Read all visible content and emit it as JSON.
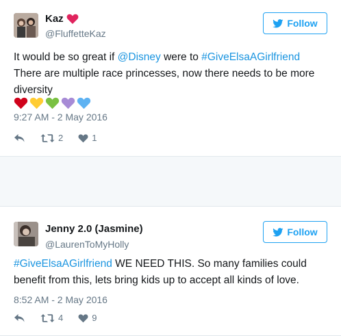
{
  "tweets": [
    {
      "display_name": "Kaz",
      "handle": "@FluffetteKaz",
      "follow_label": "Follow",
      "text_parts": [
        {
          "t": "It would be so great if ",
          "link": false
        },
        {
          "t": "@Disney",
          "link": true
        },
        {
          "t": " were to ",
          "link": false
        },
        {
          "t": "#GiveElsaAGirlfriend",
          "link": true
        },
        {
          "t": " There are multiple race princesses, now there needs to be more diversity",
          "link": false
        }
      ],
      "emoji_hearts": [
        "#d0021b",
        "#ffcc33",
        "#7ac142",
        "#a78bd6",
        "#5eb2f2"
      ],
      "timestamp": "9:27 AM - 2 May 2016",
      "retweets": "2",
      "likes": "1"
    },
    {
      "display_name": "Jenny 2.0 (Jasmine)",
      "handle": "@LaurenToMyHolly",
      "follow_label": "Follow",
      "text_parts": [
        {
          "t": "#GiveElsaAGirlfriend",
          "link": true
        },
        {
          "t": " WE NEED THIS. So many families could benefit from this, lets bring kids up to accept all kinds of love.",
          "link": false
        }
      ],
      "timestamp": "8:52 AM - 2 May 2016",
      "retweets": "4",
      "likes": "9"
    }
  ],
  "colors": {
    "accent": "#1da1f2",
    "link": "#1b95e0",
    "muted": "#657786",
    "background": "#f5f8fa",
    "name_heart": "#e0245e"
  },
  "icons": {
    "reply": "reply-icon",
    "retweet": "retweet-icon",
    "like": "heart-icon",
    "follow": "twitter-bird-icon"
  }
}
